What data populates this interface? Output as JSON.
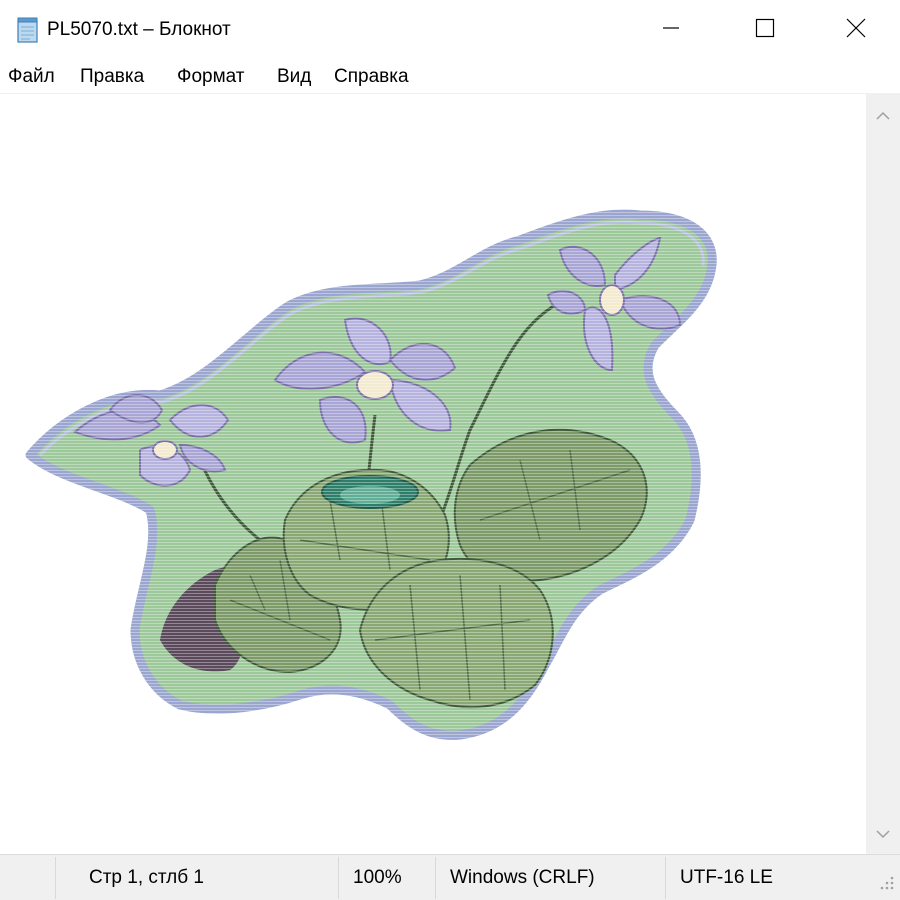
{
  "window": {
    "title": "PL5070.txt – Блокнот",
    "app_icon": "notepad-icon",
    "controls": {
      "minimize": "minimize-icon",
      "maximize": "maximize-icon",
      "close": "close-icon"
    }
  },
  "menu": {
    "items": [
      {
        "label": "Файл"
      },
      {
        "label": "Правка"
      },
      {
        "label": "Формат"
      },
      {
        "label": "Вид"
      },
      {
        "label": "Справка"
      }
    ]
  },
  "editor": {
    "content": "ASCII-art illustration of a violet plant with three lilac flowers and green leaves",
    "colors": {
      "background_blob": "#9cc89a",
      "outline": "#9aa6cf",
      "leaf": "#7d9a69",
      "leaf_dark": "#5e7a50",
      "petal": "#a9a6d6",
      "petal_dark": "#7a6fa8",
      "shadow": "#5a4a5c",
      "teal": "#2e7f6a"
    }
  },
  "scrollbar": {
    "up_icon": "chevron-up-icon",
    "down_icon": "chevron-down-icon"
  },
  "status": {
    "position": "Стр 1, стлб 1",
    "zoom": "100%",
    "line_endings": "Windows (CRLF)",
    "encoding": "UTF-16 LE"
  }
}
